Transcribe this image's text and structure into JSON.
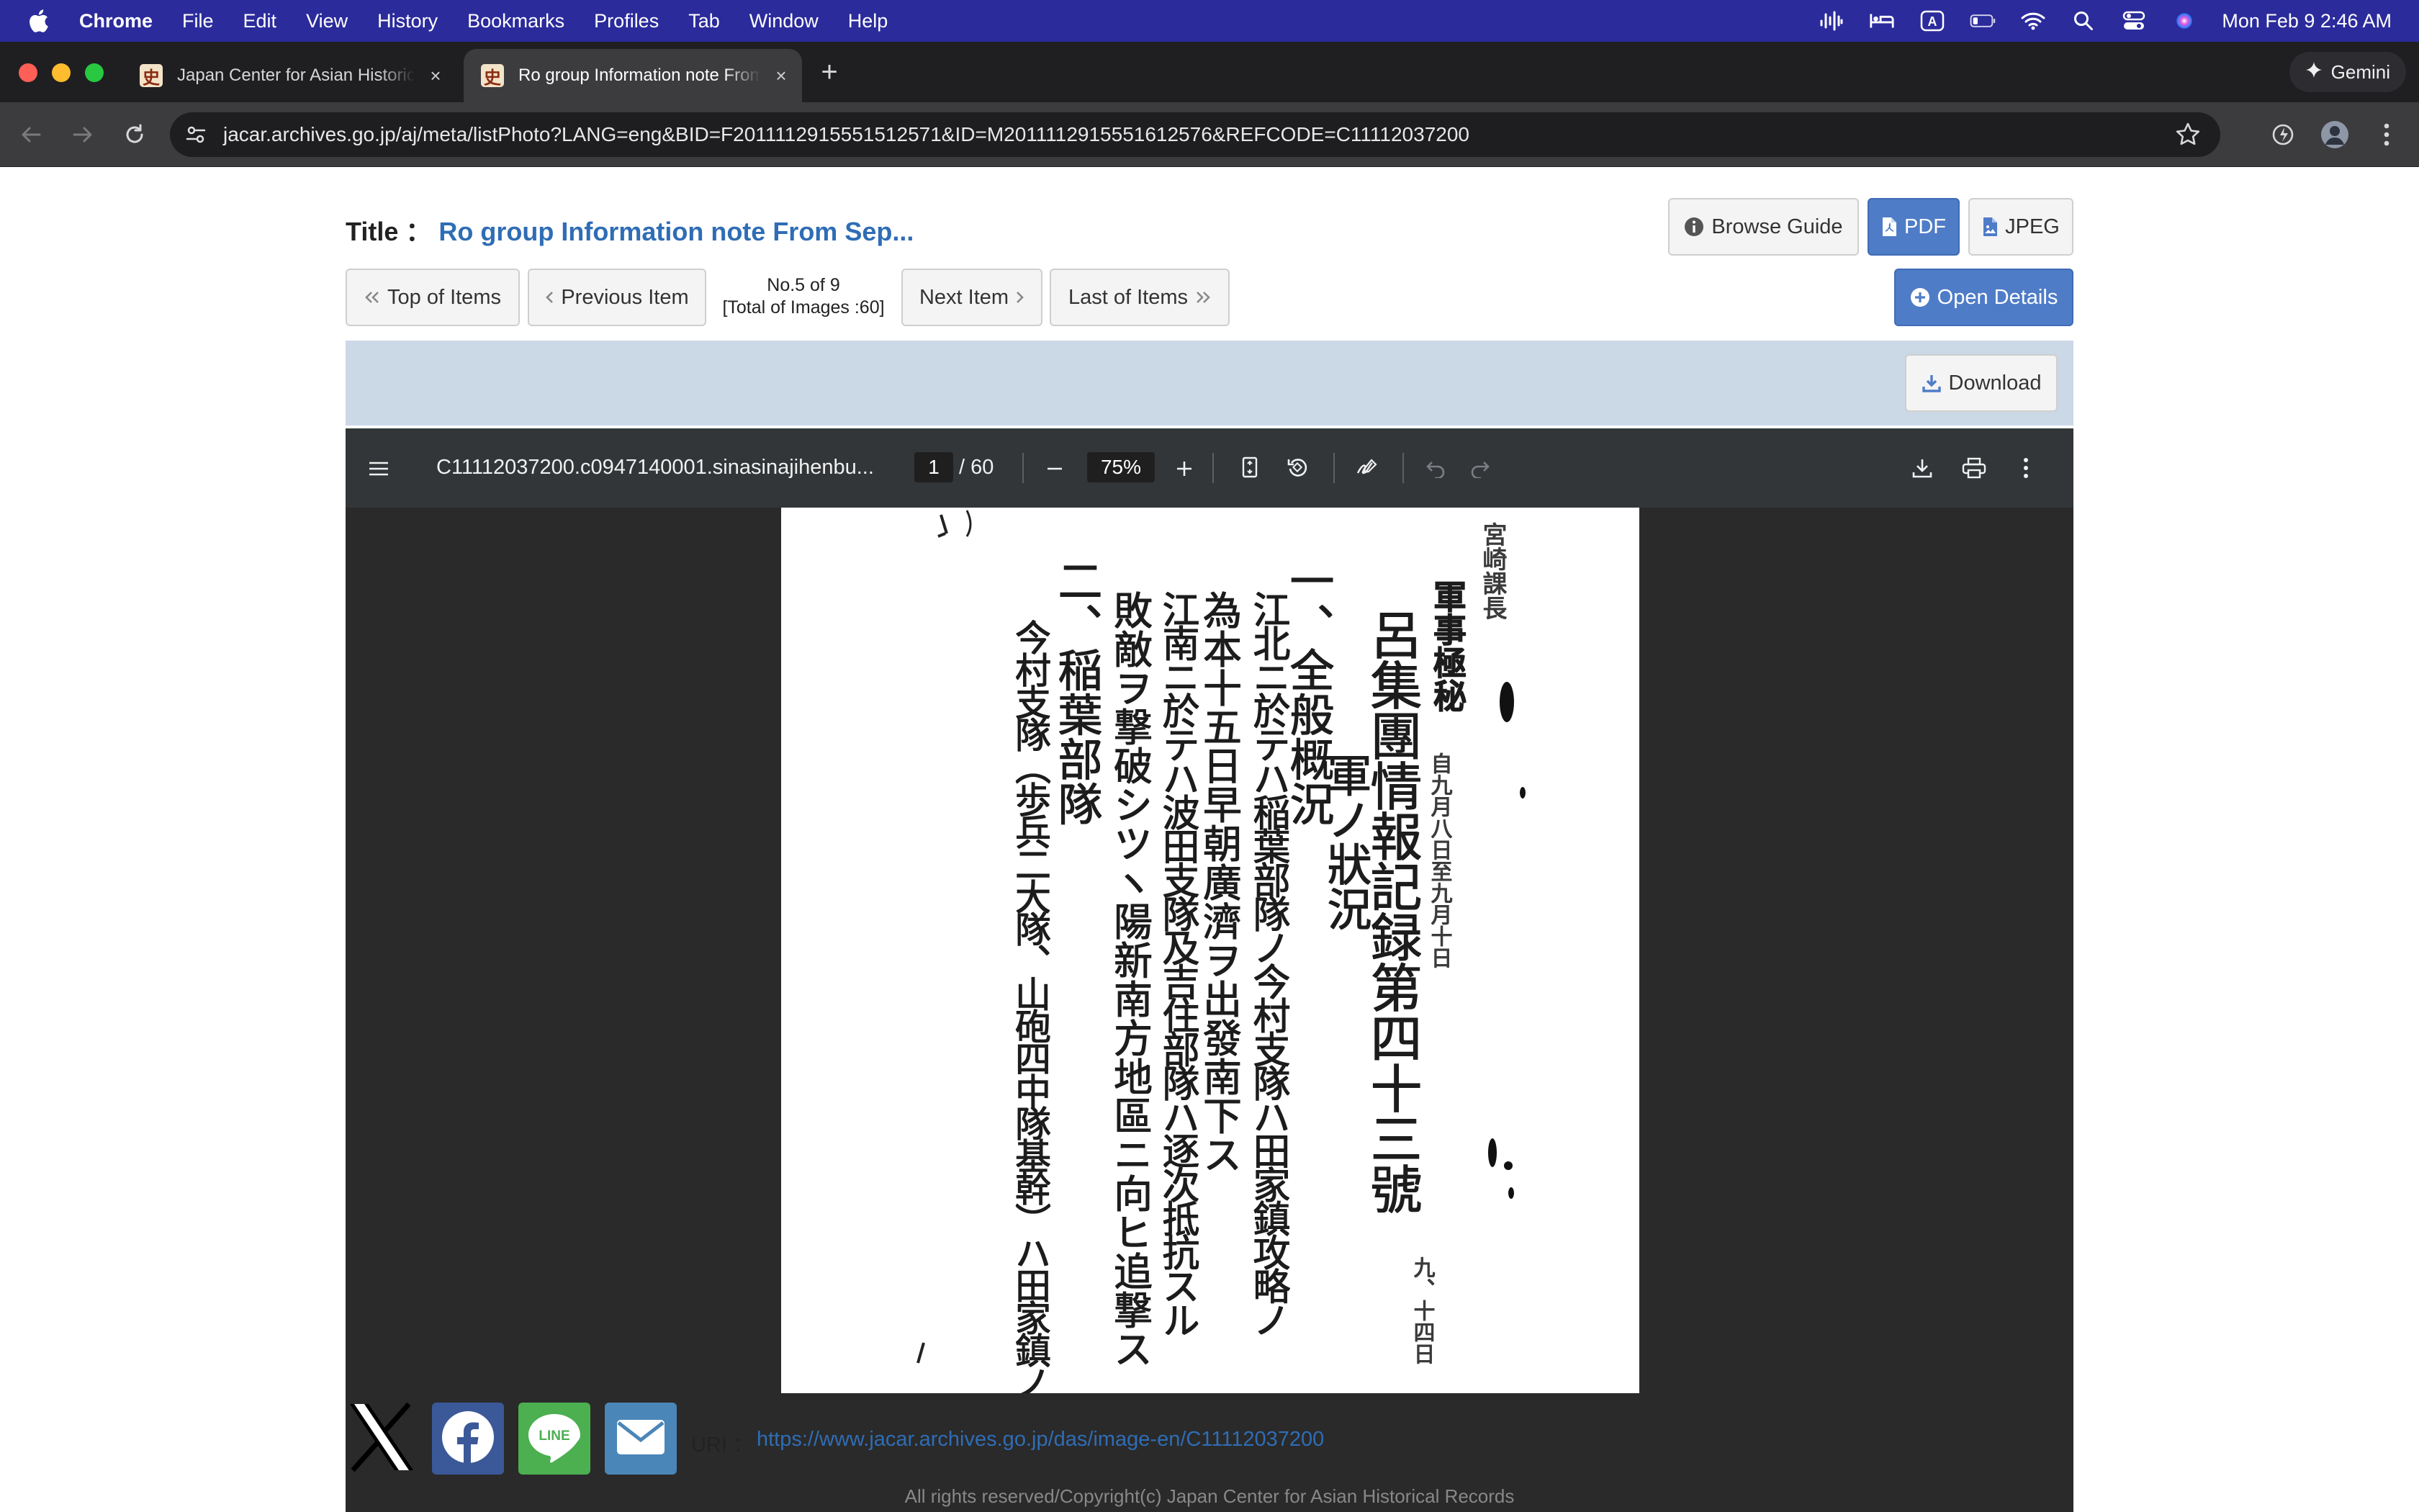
{
  "menubar": {
    "app_name": "Chrome",
    "items": [
      "File",
      "Edit",
      "View",
      "History",
      "Bookmarks",
      "Profiles",
      "Tab",
      "Window",
      "Help"
    ],
    "clock": "Mon Feb 9  2:46 AM",
    "background": "#2b2b9c"
  },
  "tabs": [
    {
      "title": "Japan Center for Asian Historical Records",
      "favicon": "史",
      "active": false
    },
    {
      "title": "Ro group Information note From September",
      "favicon": "史",
      "active": true
    }
  ],
  "gemini_label": "Gemini",
  "address": {
    "url": "jacar.archives.go.jp/aj/meta/listPhoto?LANG=eng&BID=F2011112915551512571&ID=M2011112915551612576&REFCODE=C11112037200"
  },
  "page": {
    "title_label": "Title",
    "title_colon": "：",
    "title_value": "Ro group Information note From Sep...",
    "buttons": {
      "browse_guide": "Browse Guide",
      "pdf": "PDF",
      "jpeg": "JPEG",
      "top_of_items": "Top of Items",
      "previous_item": "Previous Item",
      "next_item": "Next Item",
      "last_of_items": "Last of Items",
      "open_details": "Open Details",
      "download": "Download"
    },
    "counter_line1": "No.5 of 9",
    "counter_line2": "[Total of Images :60]"
  },
  "pdf_viewer": {
    "filename": "C11112037200.c0947140001.sinasinajihenbu...",
    "current_page": "1",
    "total_pages": "/ 60",
    "zoom": "75%"
  },
  "document_text": {
    "col1_name": "宮崎課長",
    "col2_stamp": "軍事極秘",
    "col3_title": "呂集團情報記録第四十三號",
    "col3_note": "自九月八日至九月十日",
    "col3_note2": "九、十四日",
    "col4": "軍ノ狀況",
    "col5": "一、全般概況",
    "col6": "江北ニ於テハ稲葉部隊ノ今村支隊ハ田家鎮攻略ノ",
    "col7": "為本十五日早朝廣濟ヲ出發南下ス",
    "col8": "江南ニ於テハ波田支隊及吉住部隊ハ逐次抵抗スル",
    "col9": "敗敵ヲ撃破シツヽ陽新南方地區ニ向ヒ追撃ス",
    "col10": "二、稲葉部隊",
    "col11": "今村支隊（歩兵二大隊、山砲四中隊基幹）ハ田家鎮ノ"
  },
  "share": {
    "uri_label": "URI",
    "uri_colon": "：",
    "uri": "https://www.jacar.archives.go.jp/das/image-en/C11112037200",
    "copyright": "All rights reserved/Copyright(c) Japan Center for Asian Historical Records",
    "colors": {
      "x": "#000000",
      "facebook": "#3b5998",
      "line": "#4caf50",
      "mail": "#4a86b8"
    }
  }
}
